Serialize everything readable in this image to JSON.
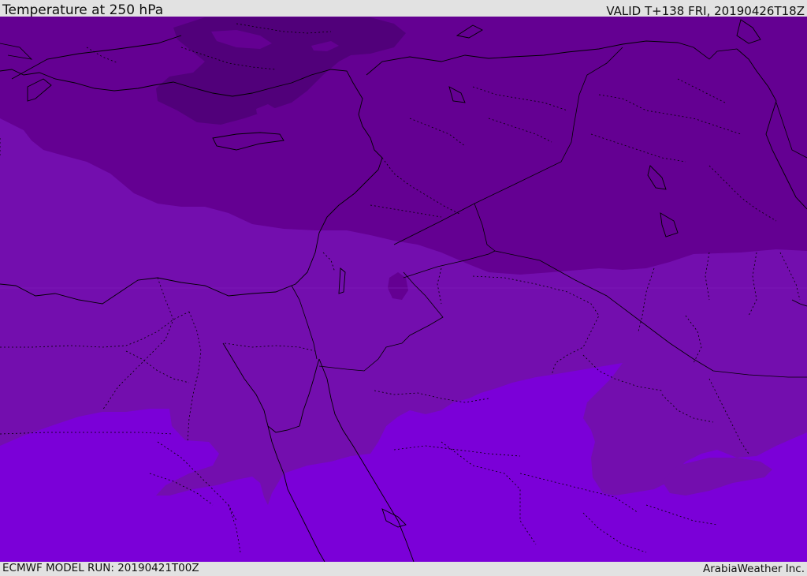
{
  "header": {
    "title": "Temperature at 250 hPa",
    "valid_time": "VALID T+138 FRI, 20190426T18Z"
  },
  "footer": {
    "model_run": "ECMWF MODEL RUN: 20190421T00Z",
    "credit": "ArabiaWeather Inc."
  },
  "map": {
    "region": "Eastern Mediterranean, Egypt, Levant, Northern Arabia",
    "field": "temperature",
    "level": "250 hPa",
    "colors": {
      "coldest": "#51007a",
      "cold": "#640092",
      "mid": "#730eae",
      "warm": "#7b00d8",
      "border": "#000000",
      "background": "#e2e2e2"
    }
  }
}
